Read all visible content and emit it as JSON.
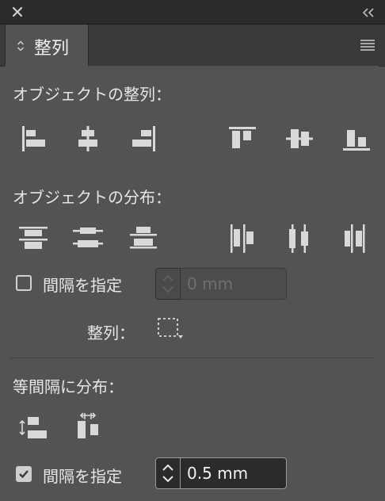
{
  "panel": {
    "tab_label": "整列",
    "tab_arrow_icon": "stepper-arrows-icon",
    "menu_icon": "panel-menu-icon",
    "close_icon": "close-icon",
    "collapse_icon": "double-chevron-left-icon"
  },
  "align_objects": {
    "label": "オブジェクトの整列：",
    "buttons": [
      "align-left-icon",
      "align-horizontal-center-icon",
      "align-right-icon",
      "align-top-icon",
      "align-vertical-center-icon",
      "align-bottom-icon"
    ]
  },
  "distribute_objects": {
    "label": "オブジェクトの分布：",
    "buttons": [
      "distribute-top-icon",
      "distribute-vertical-center-icon",
      "distribute-bottom-icon",
      "distribute-left-icon",
      "distribute-horizontal-center-icon",
      "distribute-right-icon"
    ]
  },
  "distribute_spacing_option": {
    "checkbox_label": "間隔を指定",
    "checked": false,
    "value": "0 mm"
  },
  "align_to": {
    "label": "整列：",
    "icon": "align-to-selection-icon"
  },
  "distribute_spacing": {
    "label": "等間隔に分布：",
    "buttons": [
      "vertical-distribute-space-icon",
      "horizontal-distribute-space-icon"
    ],
    "checkbox_label": "間隔を指定",
    "checked": true,
    "value": "0.5 mm"
  },
  "colors": {
    "panel_bg": "#535353",
    "title_bg": "#2b2b2b",
    "icon": "#d9d9d9"
  }
}
